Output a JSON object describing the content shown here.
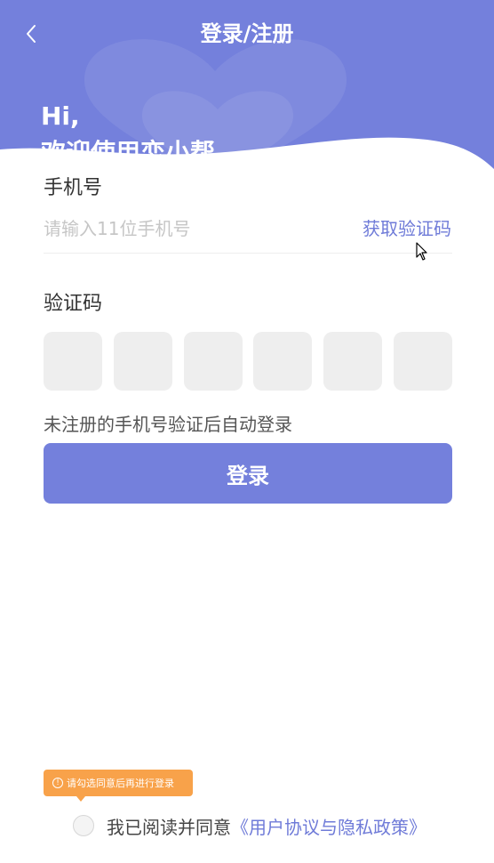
{
  "header": {
    "title": "登录/注册",
    "greeting": "Hi,",
    "welcome": "欢迎使用恋小帮",
    "background_color": "#7480dc",
    "back_icon": "chevron-left-icon"
  },
  "form": {
    "phone_label": "手机号",
    "phone_placeholder": "请输入11位手机号",
    "get_code_label": "获取验证码",
    "code_label": "验证码",
    "code_boxes": [
      "",
      "",
      "",
      "",
      "",
      ""
    ],
    "hint": "未注册的手机号验证后自动登录",
    "login_label": "登录",
    "accent_color": "#6f7bd8"
  },
  "agreement": {
    "tooltip": "请勾选同意后再进行登录",
    "tooltip_icon": "info-icon",
    "tooltip_color": "#f8a24a",
    "text": "我已阅读并同意",
    "link": "《用户协议与隐私政策》",
    "checked": false
  }
}
